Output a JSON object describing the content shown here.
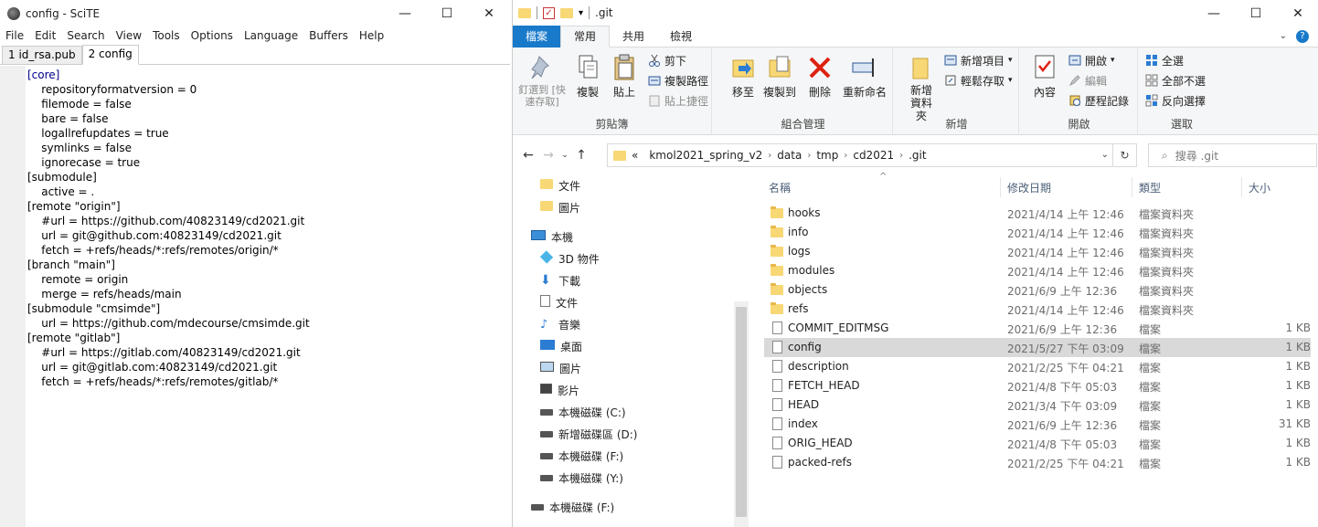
{
  "scite": {
    "title": "config - SciTE",
    "window_controls": {
      "minimize": "—",
      "maximize": "☐",
      "close": "✕"
    },
    "menu": [
      "File",
      "Edit",
      "Search",
      "View",
      "Tools",
      "Options",
      "Language",
      "Buffers",
      "Help"
    ],
    "tabs": [
      "1 id_rsa.pub",
      "2 config"
    ],
    "lines": [
      "[core]",
      "    repositoryformatversion = 0",
      "    filemode = false",
      "    bare = false",
      "    logallrefupdates = true",
      "    symlinks = false",
      "    ignorecase = true",
      "[submodule]",
      "    active = .",
      "[remote \"origin\"]",
      "    #url = https://github.com/40823149/cd2021.git",
      "    url = git@github.com:40823149/cd2021.git",
      "    fetch = +refs/heads/*:refs/remotes/origin/*",
      "[branch \"main\"]",
      "    remote = origin",
      "    merge = refs/heads/main",
      "[submodule \"cmsimde\"]",
      "    url = https://github.com/mdecourse/cmsimde.git",
      "[remote \"gitlab\"]",
      "    #url = https://gitlab.com/40823149/cd2021.git",
      "    url = git@gitlab.com:40823149/cd2021.git",
      "    fetch = +refs/heads/*:refs/remotes/gitlab/*"
    ]
  },
  "explorer": {
    "title": ".git",
    "ribbon_tabs": [
      "檔案",
      "常用",
      "共用",
      "檢視"
    ],
    "ribbon": {
      "clipboard": {
        "pin": "釘選到 [快速存取]",
        "copy": "複製",
        "paste": "貼上",
        "cut": "剪下",
        "copy_path": "複製路徑",
        "paste_shortcut": "貼上捷徑",
        "label": "剪貼簿"
      },
      "organize": {
        "move_to": "移至",
        "copy_to": "複製到",
        "delete": "刪除",
        "rename": "重新命名",
        "label": "組合管理"
      },
      "new": {
        "new_folder": "新增資料夾",
        "new_item": "新增項目",
        "easy_access": "輕鬆存取",
        "label": "新增"
      },
      "open": {
        "properties": "內容",
        "open": "開啟",
        "edit": "編輯",
        "history": "歷程記錄",
        "label": "開啟"
      },
      "select": {
        "select_all": "全選",
        "select_none": "全部不選",
        "invert": "反向選擇",
        "label": "選取"
      }
    },
    "address": [
      "«",
      "kmol2021_spring_v2",
      "data",
      "tmp",
      "cd2021",
      ".git"
    ],
    "search_placeholder": "搜尋 .git",
    "nav": [
      {
        "label": "文件",
        "icon": "folder-icon"
      },
      {
        "label": "圖片",
        "icon": "folder-icon"
      },
      {
        "label": "本機",
        "icon": "computer-icon"
      },
      {
        "label": "3D 物件",
        "icon": "3d-objects-icon"
      },
      {
        "label": "下載",
        "icon": "download-icon"
      },
      {
        "label": "文件",
        "icon": "documents-icon"
      },
      {
        "label": "音樂",
        "icon": "music-icon"
      },
      {
        "label": "桌面",
        "icon": "desktop-icon"
      },
      {
        "label": "圖片",
        "icon": "pictures-icon"
      },
      {
        "label": "影片",
        "icon": "videos-icon"
      },
      {
        "label": "本機磁碟 (C:)",
        "icon": "drive-icon"
      },
      {
        "label": "新增磁碟區 (D:)",
        "icon": "drive-icon"
      },
      {
        "label": "本機磁碟 (F:)",
        "icon": "drive-icon"
      },
      {
        "label": "本機磁碟 (Y:)",
        "icon": "drive-icon"
      },
      {
        "label": "本機磁碟 (F:)",
        "icon": "drive-icon"
      }
    ],
    "columns": {
      "name": "名稱",
      "date": "修改日期",
      "type": "類型",
      "size": "大小"
    },
    "files": [
      {
        "name": "hooks",
        "date": "2021/4/14 上午 12:46",
        "type": "檔案資料夾",
        "size": "",
        "kind": "folder"
      },
      {
        "name": "info",
        "date": "2021/4/14 上午 12:46",
        "type": "檔案資料夾",
        "size": "",
        "kind": "folder"
      },
      {
        "name": "logs",
        "date": "2021/4/14 上午 12:46",
        "type": "檔案資料夾",
        "size": "",
        "kind": "folder"
      },
      {
        "name": "modules",
        "date": "2021/4/14 上午 12:46",
        "type": "檔案資料夾",
        "size": "",
        "kind": "folder"
      },
      {
        "name": "objects",
        "date": "2021/6/9 上午 12:36",
        "type": "檔案資料夾",
        "size": "",
        "kind": "folder"
      },
      {
        "name": "refs",
        "date": "2021/4/14 上午 12:46",
        "type": "檔案資料夾",
        "size": "",
        "kind": "folder"
      },
      {
        "name": "COMMIT_EDITMSG",
        "date": "2021/6/9 上午 12:36",
        "type": "檔案",
        "size": "1 KB",
        "kind": "file"
      },
      {
        "name": "config",
        "date": "2021/5/27 下午 03:09",
        "type": "檔案",
        "size": "1 KB",
        "kind": "file",
        "selected": true
      },
      {
        "name": "description",
        "date": "2021/2/25 下午 04:21",
        "type": "檔案",
        "size": "1 KB",
        "kind": "file"
      },
      {
        "name": "FETCH_HEAD",
        "date": "2021/4/8 下午 05:03",
        "type": "檔案",
        "size": "1 KB",
        "kind": "file"
      },
      {
        "name": "HEAD",
        "date": "2021/3/4 下午 03:09",
        "type": "檔案",
        "size": "1 KB",
        "kind": "file"
      },
      {
        "name": "index",
        "date": "2021/6/9 上午 12:36",
        "type": "檔案",
        "size": "31 KB",
        "kind": "file"
      },
      {
        "name": "ORIG_HEAD",
        "date": "2021/4/8 下午 05:03",
        "type": "檔案",
        "size": "1 KB",
        "kind": "file"
      },
      {
        "name": "packed-refs",
        "date": "2021/2/25 下午 04:21",
        "type": "檔案",
        "size": "1 KB",
        "kind": "file"
      }
    ]
  }
}
